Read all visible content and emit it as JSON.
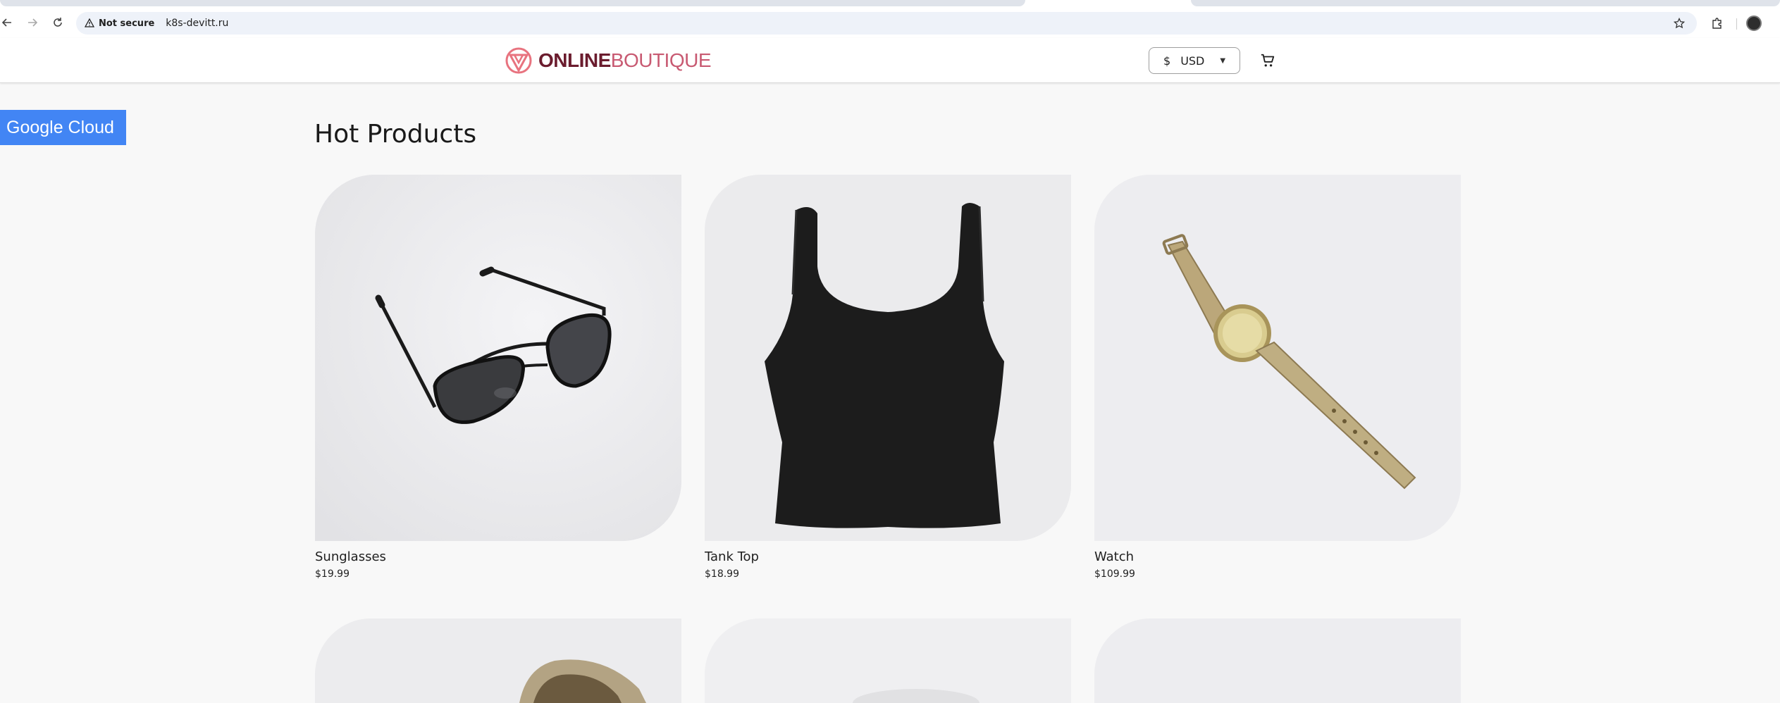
{
  "browser": {
    "security_label": "Not secure",
    "url": "k8s-devitt.ru"
  },
  "header": {
    "logo_part1": "ONLINE",
    "logo_part2": "BOUTIQUE",
    "currency_symbol": "$",
    "currency_code": "USD",
    "accent_color": "#6b1c2e",
    "logo_mark_color": "#e8737f"
  },
  "badge": {
    "label": "Google Cloud",
    "color": "#4285f4"
  },
  "main": {
    "title": "Hot Products",
    "products": [
      {
        "name": "Sunglasses",
        "price": "$19.99"
      },
      {
        "name": "Tank Top",
        "price": "$18.99"
      },
      {
        "name": "Watch",
        "price": "$109.99"
      }
    ]
  }
}
